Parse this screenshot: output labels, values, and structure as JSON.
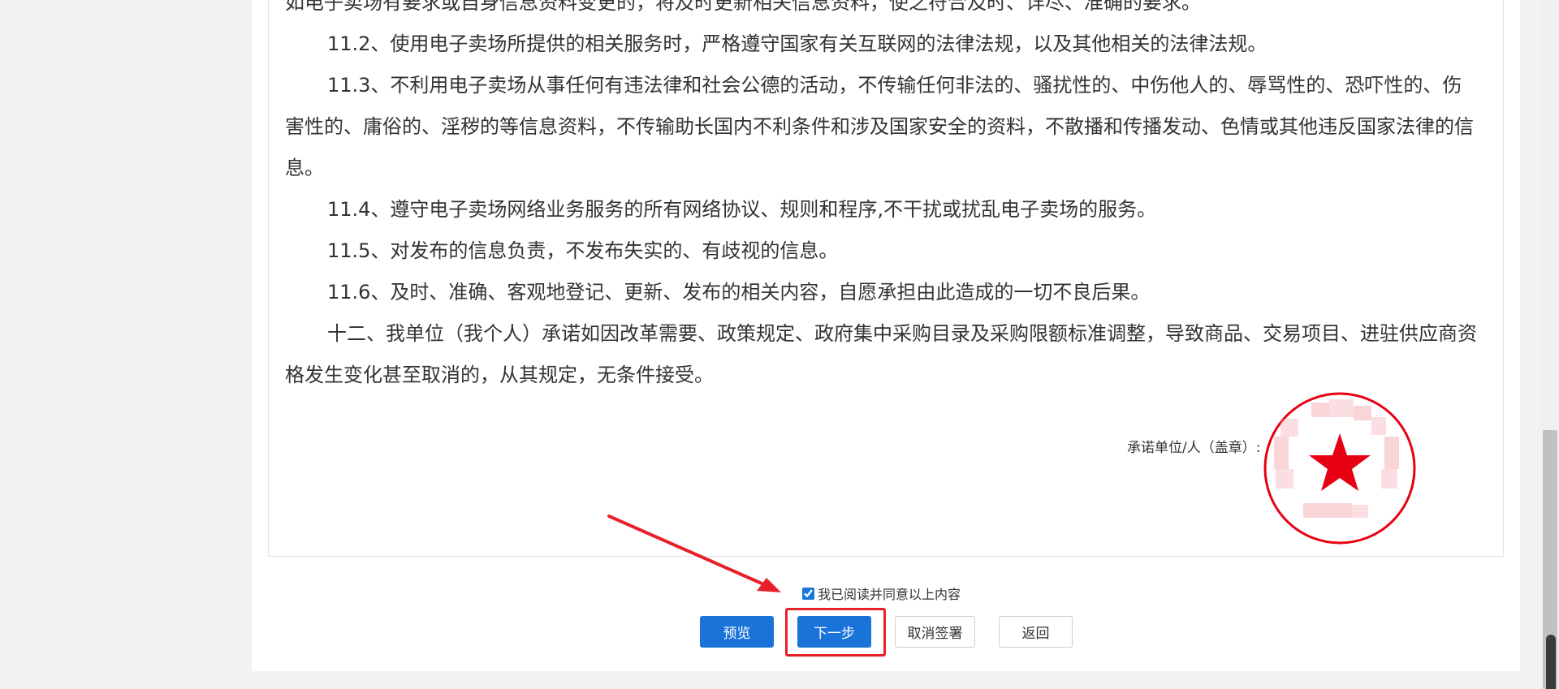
{
  "document": {
    "paragraphs": [
      "如电子卖场有要求或自身信息资料变更的，将及时更新相关信息资料，使之符合及时、详尽、准确的要求。",
      "11.2、使用电子卖场所提供的相关服务时，严格遵守国家有关互联网的法律法规，以及其他相关的法律法规。",
      "11.3、不利用电子卖场从事任何有违法律和社会公德的活动，不传输任何非法的、骚扰性的、中伤他人的、辱骂性的、恐吓性的、伤害性的、庸俗的、淫秽的等信息资料，不传输助长国内不利条件和涉及国家安全的资料，不散播和传播发动、色情或其他违反国家法律的信息。",
      "11.4、遵守电子卖场网络业务服务的所有网络协议、规则和程序,不干扰或扰乱电子卖场的服务。",
      "11.5、对发布的信息负责，不发布失实的、有歧视的信息。",
      "11.6、及时、准确、客观地登记、更新、发布的相关内容，自愿承担由此造成的一切不良后果。",
      "十二、我单位（我个人）承诺如因改革需要、政策规定、政府集中采购目录及采购限额标准调整，导致商品、交易项目、进驻供应商资格发生变化甚至取消的，从其规定，无条件接受。"
    ],
    "signature_label": "承诺单位/人（盖章）:",
    "seal": {
      "color": "#e60012",
      "icon": "star-icon"
    }
  },
  "agreement": {
    "checkbox_label": "我已阅读并同意以上内容",
    "checked": true
  },
  "buttons": {
    "preview": "预览",
    "next": "下一步",
    "cancel_sign": "取消签署",
    "back": "返回"
  },
  "colors": {
    "primary": "#1a73d9",
    "annotation": "#e8202a"
  }
}
